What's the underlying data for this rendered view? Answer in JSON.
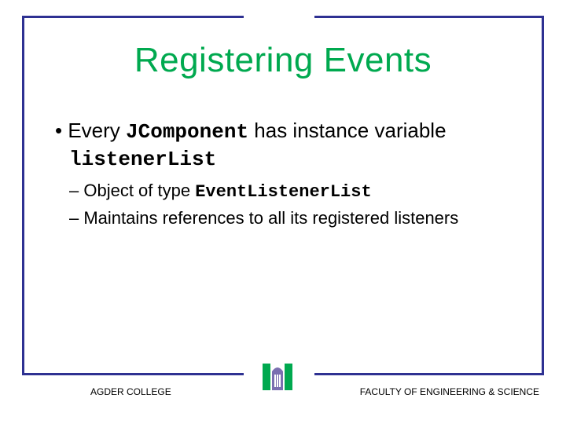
{
  "title": "Registering Events",
  "bullet1": {
    "pre": "Every ",
    "code1": "JComponent",
    "mid": " has instance variable ",
    "code2": "listenerList"
  },
  "sub1": {
    "pre": "Object of type ",
    "code": "EventListenerList"
  },
  "sub2": "Maintains references to all its registered listeners",
  "footer": {
    "left": "AGDER COLLEGE",
    "right": "FACULTY OF ENGINEERING & SCIENCE"
  },
  "icons": {
    "logo": "column-logo"
  },
  "colors": {
    "accent_green": "#00a94f",
    "frame_blue": "#2e3192",
    "logo_purple": "#7a6fb0"
  }
}
